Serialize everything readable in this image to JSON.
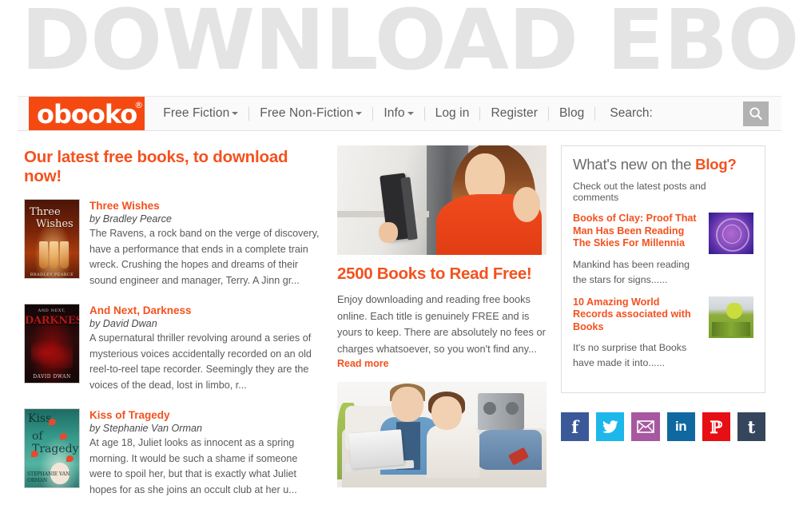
{
  "banner": {
    "wordmark": "DOWNLOAD EBOOKS"
  },
  "nav": {
    "logo_text": "obooko",
    "logo_reg": "®",
    "items": [
      {
        "label": "Free Fiction",
        "caret": true
      },
      {
        "label": "Free Non-Fiction",
        "caret": true
      },
      {
        "label": "Info",
        "caret": true
      },
      {
        "label": "Log in",
        "caret": false
      },
      {
        "label": "Register",
        "caret": false
      },
      {
        "label": "Blog",
        "caret": false
      }
    ],
    "search_label": "Search:",
    "search_icon": "search-icon"
  },
  "left": {
    "heading": "Our latest free books, to download now!",
    "books": [
      {
        "title": "Three Wishes",
        "author": "by Bradley Pearce",
        "description": "The Ravens, a rock band on the verge of discovery, have a performance that ends in a complete train wreck. Crushing the hopes and dreams of their sound engineer and manager, Terry. A Jinn gr...",
        "cover_title_line1": "Three",
        "cover_title_line2": "Wishes",
        "cover_byline": "BRADLEY PEARCE"
      },
      {
        "title": "And Next, Darkness",
        "author": "by David Dwan",
        "description": "A supernatural thriller revolving around a series of mysterious voices accidentally recorded on an old reel-to-reel tape recorder. Seemingly they are the voices of the dead, lost in limbo, r...",
        "cover_title_line1": "AND NEXT,",
        "cover_title_line2": "DARKNESS",
        "cover_byline": "DAVID DWAN"
      },
      {
        "title": "Kiss of Tragedy",
        "author": "by Stephanie Van Orman",
        "description": "At age 18, Juliet looks as innocent as a spring morning. It would be such a shame if someone were to spoil her, but that is exactly what Juliet hopes for as she joins an occult club at her u...",
        "cover_title_line1": "Kiss",
        "cover_title_line2": "of Tragedy",
        "cover_byline": "STEPHANIE VAN ORMAN"
      }
    ]
  },
  "mid": {
    "hero_image_alt": "woman-reading-tablet-photo",
    "hero2_image_alt": "couple-on-sofa-with-laptop-photo",
    "title": "2500 Books to Read Free!",
    "body": "Enjoy downloading and reading free books online. Each title is genuinely FREE and is yours to keep. There are absolutely no fees or charges whatsoever, so you won't find any...",
    "read_more": "Read more"
  },
  "right": {
    "blog_heading_prefix": "What's new on the ",
    "blog_heading_accent": "Blog?",
    "blog_subtitle": "Check out the latest posts and comments",
    "posts": [
      {
        "title": "Books of Clay: Proof That Man Has Been Reading The Skies For Millennia",
        "excerpt": "Mankind has been reading the stars for signs......",
        "thumb": "zodiac-disc-thumbnail"
      },
      {
        "title": "10 Amazing World Records associated with Books",
        "excerpt": "It's no surprise that Books have made it into......",
        "thumb": "world-records-books-thumbnail"
      }
    ],
    "social": [
      {
        "name": "facebook",
        "glyph": "f"
      },
      {
        "name": "twitter",
        "glyph": ""
      },
      {
        "name": "email",
        "glyph": ""
      },
      {
        "name": "linkedin",
        "glyph": "in"
      },
      {
        "name": "pinterest",
        "glyph": "ℙ"
      },
      {
        "name": "tumblr",
        "glyph": "t"
      }
    ]
  },
  "colors": {
    "brand_orange": "#f4511e",
    "logo_orange": "#f44a12",
    "banner_gray": "#e4e4e4",
    "facebook": "#3b5998",
    "twitter": "#1cb7eb",
    "email": "#a758a0",
    "linkedin": "#1068a0",
    "pinterest": "#e60f14",
    "tumblr": "#35465c"
  }
}
